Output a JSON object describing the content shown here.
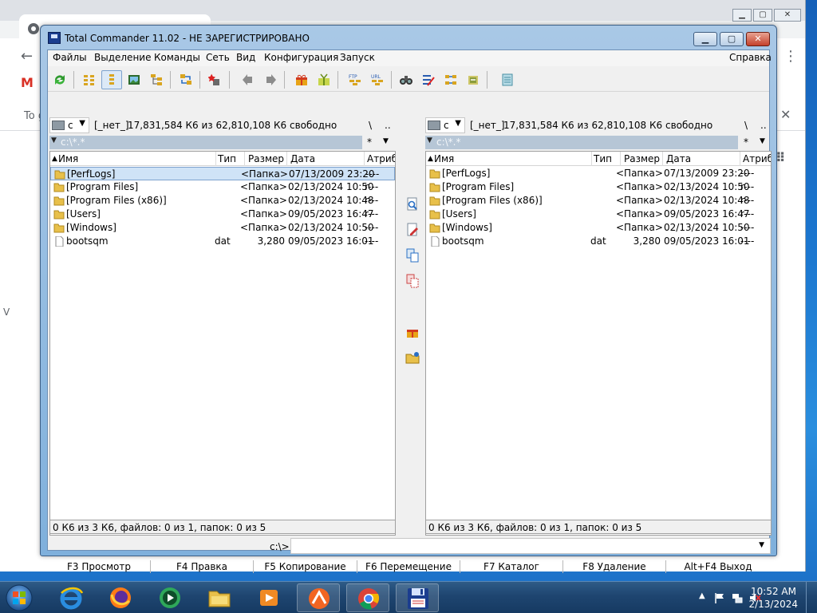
{
  "window": {
    "title": "Total Commander 11.02 - НЕ ЗАРЕГИСТРИРОВАНО",
    "min": "▁",
    "max": "▢",
    "close": "✕"
  },
  "menu": {
    "items": [
      "Файлы",
      "Выделение",
      "Команды",
      "Сеть",
      "Вид",
      "Конфигурация",
      "Запуск"
    ],
    "help": "Справка"
  },
  "toolbar_icons": {
    "ftp": "FTP",
    "url": "URL"
  },
  "left": {
    "drive": "c",
    "drive_label": "[_нет_]",
    "free": "17,831,584 К6 из 62,810,108 К6 свободно",
    "root_btn": "\\",
    "up_btn": "..",
    "path": "c:\\*.*",
    "filter": "*",
    "status": "0 К6 из 3 К6, файлов: 0 из 1, папок: 0 из 5",
    "columns": {
      "name": "Имя",
      "type": "Тип",
      "size": "Размер",
      "date": "Дата",
      "attr": "Атриб"
    },
    "rows": [
      {
        "name": "[PerfLogs]",
        "ext": "",
        "size": "<Папка>",
        "date": "07/13/2009 23:20",
        "attr": "----"
      },
      {
        "name": "[Program Files]",
        "ext": "",
        "size": "<Папка>",
        "date": "02/13/2024 10:50",
        "attr": "r---"
      },
      {
        "name": "[Program Files (x86)]",
        "ext": "",
        "size": "<Папка>",
        "date": "02/13/2024 10:48",
        "attr": "r---"
      },
      {
        "name": "[Users]",
        "ext": "",
        "size": "<Папка>",
        "date": "09/05/2023 16:47",
        "attr": "r---"
      },
      {
        "name": "[Windows]",
        "ext": "",
        "size": "<Папка>",
        "date": "02/13/2024 10:50",
        "attr": "----"
      },
      {
        "name": "bootsqm",
        "ext": "dat",
        "size": "3,280",
        "date": "09/05/2023 16:01",
        "attr": "----"
      }
    ]
  },
  "right": {
    "drive": "c",
    "drive_label": "[_нет_]",
    "free": "17,831,584 К6 из 62,810,108 К6 свободно",
    "root_btn": "\\",
    "up_btn": "..",
    "path": "c:\\*.*",
    "filter": "*",
    "status": "0 К6 из 3 К6, файлов: 0 из 1, папок: 0 из 5",
    "columns": {
      "name": "Имя",
      "type": "Тип",
      "size": "Размер",
      "date": "Дата",
      "attr": "Атриб"
    },
    "rows": [
      {
        "name": "[PerfLogs]",
        "ext": "",
        "size": "<Папка>",
        "date": "07/13/2009 23:20",
        "attr": "----"
      },
      {
        "name": "[Program Files]",
        "ext": "",
        "size": "<Папка>",
        "date": "02/13/2024 10:50",
        "attr": "r---"
      },
      {
        "name": "[Program Files (x86)]",
        "ext": "",
        "size": "<Папка>",
        "date": "02/13/2024 10:48",
        "attr": "r---"
      },
      {
        "name": "[Users]",
        "ext": "",
        "size": "<Папка>",
        "date": "09/05/2023 16:47",
        "attr": "r---"
      },
      {
        "name": "[Windows]",
        "ext": "",
        "size": "<Папка>",
        "date": "02/13/2024 10:50",
        "attr": "----"
      },
      {
        "name": "bootsqm",
        "ext": "dat",
        "size": "3,280",
        "date": "09/05/2023 16:01",
        "attr": "----"
      }
    ]
  },
  "cmdline": {
    "label": "c:\\>",
    "value": ""
  },
  "fkeys": [
    "F3 Просмотр",
    "F4 Правка",
    "F5 Копирование",
    "F6 Перемещение",
    "F7 Каталог",
    "F8 Удаление",
    "Alt+F4 Выход"
  ],
  "background_chrome": {
    "infobar_text": "To g",
    "side_letter": "V"
  },
  "taskbar": {
    "time": "10:52 AM",
    "date": "2/13/2024",
    "apps": [
      "internet-explorer",
      "firefox",
      "media-center",
      "file-explorer",
      "media-player",
      "app-orange",
      "chrome",
      "total-commander"
    ]
  },
  "colors": {
    "selection": "#cfe3f7",
    "path_bar": "#b6c6d6",
    "taskbar": "#1e4570"
  }
}
